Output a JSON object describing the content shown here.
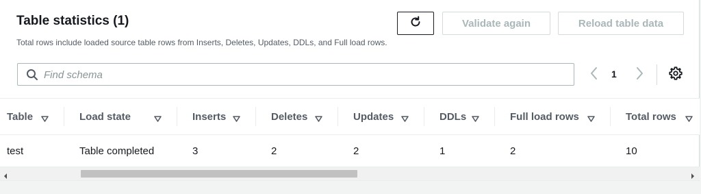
{
  "header": {
    "title": "Table statistics (1)",
    "description": "Total rows include loaded source table rows from Inserts, Deletes, Updates, DDLs, and Full load rows.",
    "refresh_icon": "refresh-icon",
    "validate_label": "Validate again",
    "reload_label": "Reload table data"
  },
  "search": {
    "placeholder": "Find schema",
    "value": "",
    "icon": "search-icon"
  },
  "pagination": {
    "current_page": "1",
    "prev_icon": "chevron-left-icon",
    "next_icon": "chevron-right-icon"
  },
  "settings": {
    "icon": "gear-icon"
  },
  "table": {
    "columns": [
      "Table",
      "Load state",
      "Inserts",
      "Deletes",
      "Updates",
      "DDLs",
      "Full load rows",
      "Total rows"
    ],
    "sort_icon": "sort-caret-down-icon",
    "rows": [
      [
        "test",
        "Table completed",
        "3",
        "2",
        "2",
        "1",
        "2",
        "10"
      ]
    ]
  },
  "scrollbar": {
    "left_icon": "scroll-left-arrow-icon",
    "right_icon": "scroll-right-arrow-icon"
  },
  "colors": {
    "accent_text": "#16191f",
    "muted_text": "#545b64",
    "disabled_text": "#aab7b8",
    "border": "#d5dbdb",
    "background": "#f2f3f3"
  }
}
